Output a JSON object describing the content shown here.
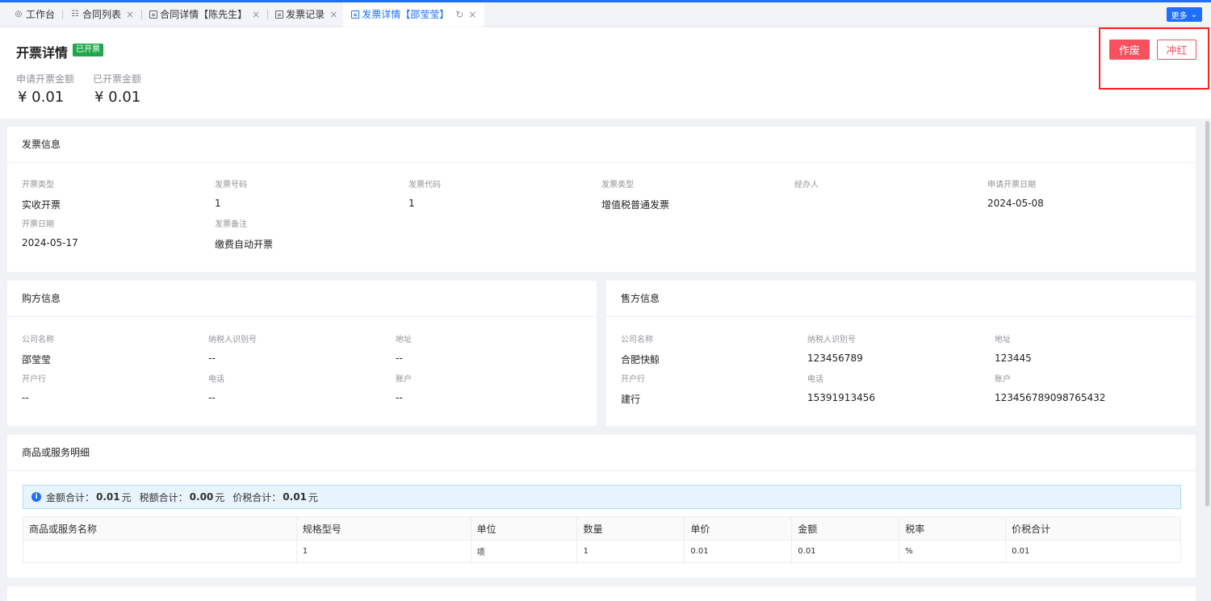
{
  "tabs": [
    {
      "label": "工作台",
      "icon": "dashboard-icon",
      "closable": false
    },
    {
      "label": "合同列表",
      "icon": "list-icon",
      "closable": true
    },
    {
      "label": "合同详情【陈先生】",
      "icon": "document-icon",
      "closable": true
    },
    {
      "label": "发票记录",
      "icon": "document-icon",
      "closable": true
    },
    {
      "label": "发票详情【邵莹莹】",
      "icon": "document-icon",
      "closable": true,
      "active": true
    }
  ],
  "more_label": "更多",
  "header": {
    "title": "开票详情",
    "status": "已开票",
    "apply_amount_label": "申请开票金额",
    "apply_amount_value": "¥ 0.01",
    "issued_amount_label": "已开票金额",
    "issued_amount_value": "¥ 0.01",
    "void_label": "作废",
    "red_label": "冲红"
  },
  "invoice_info": {
    "title": "发票信息",
    "fields": [
      {
        "label": "开票类型",
        "value": "实收开票"
      },
      {
        "label": "发票号码",
        "value": "1"
      },
      {
        "label": "发票代码",
        "value": "1"
      },
      {
        "label": "发票类型",
        "value": "增值税普通发票"
      },
      {
        "label": "经办人",
        "value": ""
      },
      {
        "label": "申请开票日期",
        "value": "2024-05-08"
      },
      {
        "label": "开票日期",
        "value": "2024-05-17"
      },
      {
        "label": "发票备注",
        "value": "缴费自动开票"
      }
    ]
  },
  "buyer_info": {
    "title": "购方信息",
    "fields": [
      {
        "label": "公司名称",
        "value": "邵莹莹"
      },
      {
        "label": "纳税人识别号",
        "value": "--"
      },
      {
        "label": "地址",
        "value": "--"
      },
      {
        "label": "开户行",
        "value": "--"
      },
      {
        "label": "电话",
        "value": "--"
      },
      {
        "label": "账户",
        "value": "--"
      }
    ]
  },
  "seller_info": {
    "title": "售方信息",
    "fields": [
      {
        "label": "公司名称",
        "value": "合肥快鲸"
      },
      {
        "label": "纳税人识别号",
        "value": "123456789"
      },
      {
        "label": "地址",
        "value": "123445"
      },
      {
        "label": "开户行",
        "value": "建行"
      },
      {
        "label": "电话",
        "value": "15391913456"
      },
      {
        "label": "账户",
        "value": "123456789098765432"
      }
    ]
  },
  "items": {
    "title": "商品或服务明细",
    "summary": {
      "amount_label": "金额合计：",
      "amount_value": "0.01",
      "tax_label": "税额合计：",
      "tax_value": "0.00",
      "total_label": "价税合计：",
      "total_value": "0.01",
      "unit": "元"
    },
    "columns": [
      "商品或服务名称",
      "规格型号",
      "单位",
      "数量",
      "单价",
      "金额",
      "税率",
      "价税合计"
    ],
    "rows": [
      [
        "",
        "1",
        "项",
        "1",
        "0.01",
        "0.01",
        "%",
        "0.01"
      ]
    ]
  },
  "colors": {
    "primary": "#1e6fff",
    "danger": "#f5515f",
    "success": "#1ea84b",
    "highlight": "#ff2020"
  }
}
